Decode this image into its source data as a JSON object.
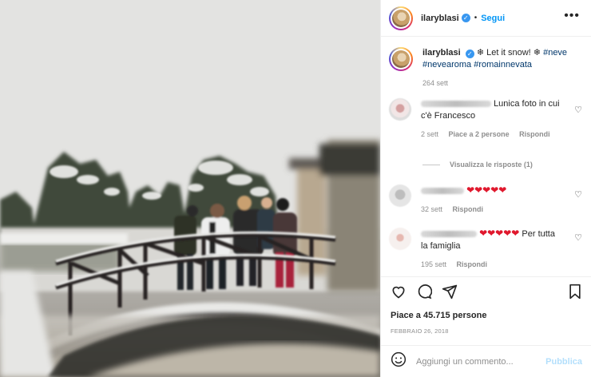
{
  "post": {
    "username": "ilaryblasi",
    "verified_mark": "✓",
    "separator": "•",
    "follow_label": "Segui",
    "more_label": "•••",
    "caption_text": "❄ Let it snow! ❄",
    "caption_tags": [
      "#neve",
      "#nevearoma",
      "#romainnevata"
    ],
    "caption_time": "264 sett"
  },
  "comments": [
    {
      "text": "Lunica foto in cui c'è Francesco",
      "time": "2 sett",
      "likes": "Piace a 2 persone",
      "reply": "Rispondi",
      "view_replies": "Visualizza le risposte (1)"
    },
    {
      "text": "",
      "hearts": "❤❤❤❤❤",
      "time": "32 sett",
      "reply": "Rispondi"
    },
    {
      "text": "Per tutta la famiglia",
      "hearts": "❤❤❤❤❤",
      "time": "195 sett",
      "reply": "Rispondi"
    }
  ],
  "actions": {
    "like_icon": "heart-outline-icon",
    "comment_icon": "comment-icon",
    "share_icon": "paper-plane-icon",
    "save_icon": "bookmark-icon",
    "likes_text": "Piace a 45.715 persone",
    "date_text": "FEBBRAIO 26, 2018"
  },
  "add_comment": {
    "emoji_icon": "smiley-icon",
    "placeholder": "Aggiungi un commento...",
    "publish_label": "Pubblica"
  },
  "colors": {
    "accent": "#0095f6",
    "hashtag": "#00376b",
    "muted": "#8e8e8e",
    "heart_red": "#e0182d",
    "publish_disabled": "#b3dffc"
  }
}
